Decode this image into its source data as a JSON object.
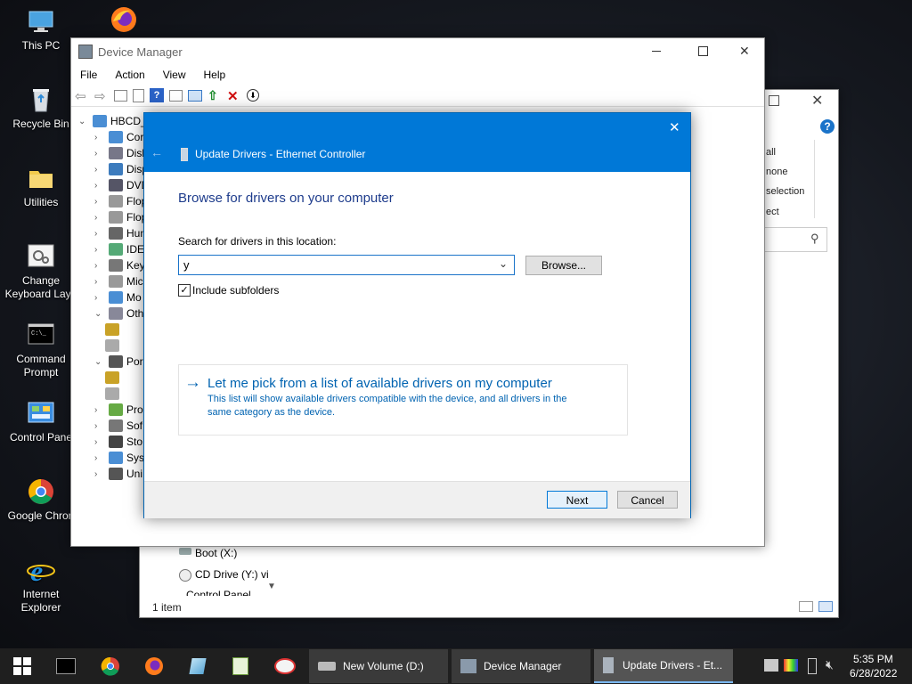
{
  "desktop": {
    "icons": [
      {
        "label": "This PC"
      },
      {
        "label": "Recycle Bin"
      },
      {
        "label": "Utilities"
      },
      {
        "label": "Change Keyboard Layo"
      },
      {
        "label": "Command Prompt"
      },
      {
        "label": "Control Pane"
      },
      {
        "label": "Google Chron"
      },
      {
        "label": "Internet Explorer"
      }
    ]
  },
  "explorer": {
    "ribbon": [
      "all",
      "none",
      "selection",
      "ect"
    ],
    "sidebar": [
      "Boot (X:)",
      "CD Drive (Y:) vi",
      "Control Panel"
    ],
    "status": "1 item"
  },
  "device_manager": {
    "title": "Device Manager",
    "menu": [
      "File",
      "Action",
      "View",
      "Help"
    ],
    "tree_root": "HBCD_",
    "tree_items": [
      "Cor",
      "Disl",
      "Disp",
      "DVD",
      "Flop",
      "Flop",
      "Hun",
      "IDE",
      "Key",
      "Mic",
      "Mo",
      "Oth",
      "",
      "",
      "Por",
      "",
      "",
      "Pro",
      "Sof",
      "Sto",
      "Sys",
      "Uni"
    ]
  },
  "dialog": {
    "title": "Update Drivers - Ethernet Controller",
    "heading": "Browse for drivers on your computer",
    "search_label": "Search for drivers in this location:",
    "path_value": "y",
    "browse_label": "Browse...",
    "include_subfolders_label": "Include subfolders",
    "include_subfolders_checked": true,
    "pick_title": "Let me pick from a list of available drivers on my computer",
    "pick_desc_1": "This list will show available drivers compatible with the device, and all drivers in the",
    "pick_desc_2": "same category as the device.",
    "next_label": "Next",
    "cancel_label": "Cancel"
  },
  "taskbar": {
    "tasks": [
      {
        "label": "New Volume (D:)"
      },
      {
        "label": "Device Manager"
      },
      {
        "label": "Update Drivers - Et..."
      }
    ],
    "time": "5:35 PM",
    "date": "6/28/2022"
  },
  "colors": {
    "accent": "#0078d7",
    "link": "#0063b1",
    "taskbar": "#1f1f1f"
  }
}
